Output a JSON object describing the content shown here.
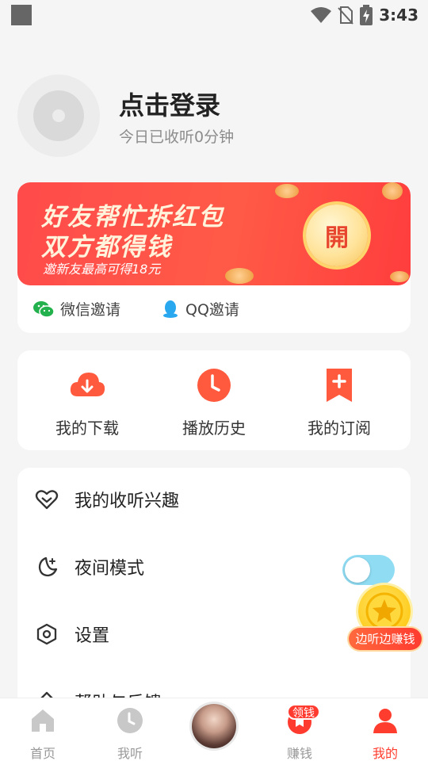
{
  "status_bar": {
    "time": "3:43"
  },
  "profile": {
    "login_title": "点击登录",
    "listen_time": "今日已收听0分钟"
  },
  "invite": {
    "banner_line1": "好友帮忙拆红包",
    "banner_line2": "双方都得钱",
    "banner_sub": "邀新友最高可得18元",
    "open_button": "開",
    "wechat_label": "微信邀请",
    "qq_label": "QQ邀请"
  },
  "quick_actions": [
    {
      "label": "我的下载",
      "icon": "download-cloud-icon"
    },
    {
      "label": "播放历史",
      "icon": "clock-icon"
    },
    {
      "label": "我的订阅",
      "icon": "bookmark-plus-icon"
    }
  ],
  "menu": [
    {
      "label": "我的收听兴趣",
      "icon": "heart-icon"
    },
    {
      "label": "夜间模式",
      "icon": "moon-icon",
      "toggle_on": false
    },
    {
      "label": "设置",
      "icon": "settings-hexagon-icon"
    },
    {
      "label": "帮助与反馈",
      "icon": "help-icon"
    }
  ],
  "float_earn": {
    "label": "边听边赚钱"
  },
  "tab_bar": {
    "tabs": [
      {
        "label": "首页",
        "icon": "home-icon",
        "active": false
      },
      {
        "label": "我听",
        "icon": "clock-icon",
        "active": false
      },
      {
        "label": "",
        "icon": "album-disc-icon",
        "active": false
      },
      {
        "label": "赚钱",
        "icon": "earn-bag-icon",
        "active": false,
        "badge": "领钱"
      },
      {
        "label": "我的",
        "icon": "person-icon",
        "active": true
      }
    ]
  },
  "colors": {
    "accent": "#ff3d2e",
    "banner_red": "#ff4b4b",
    "toggle_off": "#8fdcf3"
  }
}
